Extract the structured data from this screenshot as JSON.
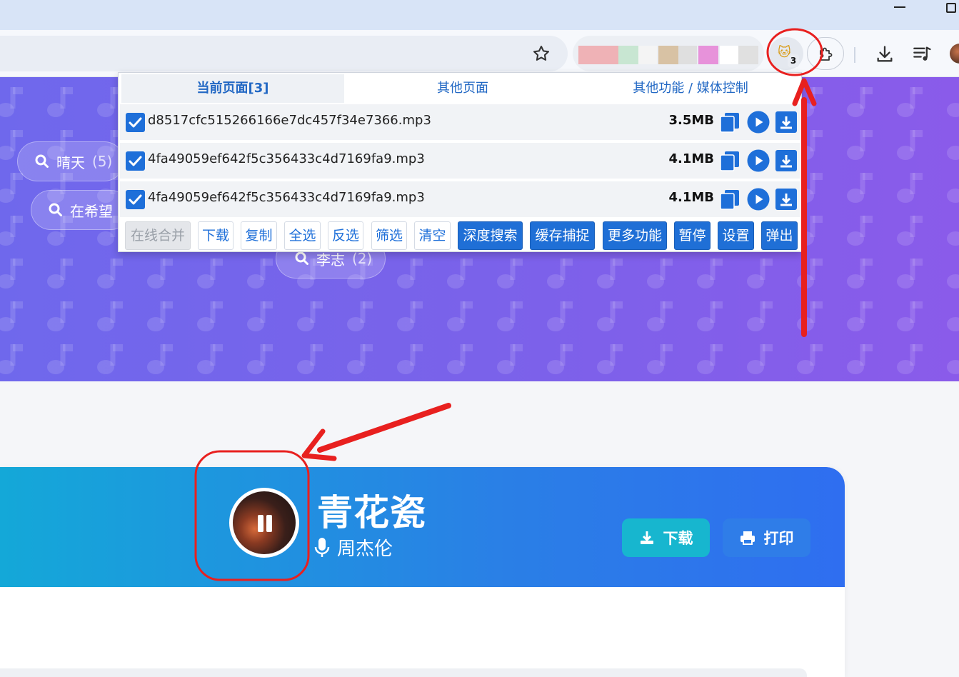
{
  "browser": {
    "extension_badge": "3",
    "extension_colors": [
      "#efb2b6",
      "#c8e6d2",
      "#f4f4f4",
      "#d8c2a4",
      "#dfdfdf",
      "#e792da",
      "#ffffff",
      "#e0e0e0"
    ]
  },
  "hero": {
    "chips": [
      {
        "label": "晴天",
        "count": "(5)"
      },
      {
        "label": "在希望",
        "count": ""
      },
      {
        "label": "李志",
        "count": "(2)"
      }
    ]
  },
  "popup": {
    "tabs": [
      "当前页面[3]",
      "其他页面",
      "其他功能 / 媒体控制"
    ],
    "files": [
      {
        "name": "d8517cfc515266166e7dc457f34e7366.mp3",
        "size": "3.5MB"
      },
      {
        "name": "4fa49059ef642f5c356433c4d7169fa9.mp3",
        "size": "4.1MB"
      },
      {
        "name": "4fa49059ef642f5c356433c4d7169fa9.mp3",
        "size": "4.1MB"
      }
    ],
    "buttons": {
      "merge": "在线合并",
      "download": "下载",
      "copy": "复制",
      "select_all": "全选",
      "invert": "反选",
      "filter": "筛选",
      "clear": "清空",
      "deep_search": "深度搜索",
      "cache_capture": "缓存捕捉",
      "more": "更多功能",
      "pause": "暂停",
      "settings": "设置",
      "popout": "弹出"
    }
  },
  "player": {
    "title": "青花瓷",
    "artist": "周杰伦",
    "download_label": "下载",
    "print_label": "打印"
  },
  "colors": {
    "accent_blue": "#1f6fd6",
    "hero_purple": "#7a62ea",
    "annotation_red": "#e8201f"
  }
}
